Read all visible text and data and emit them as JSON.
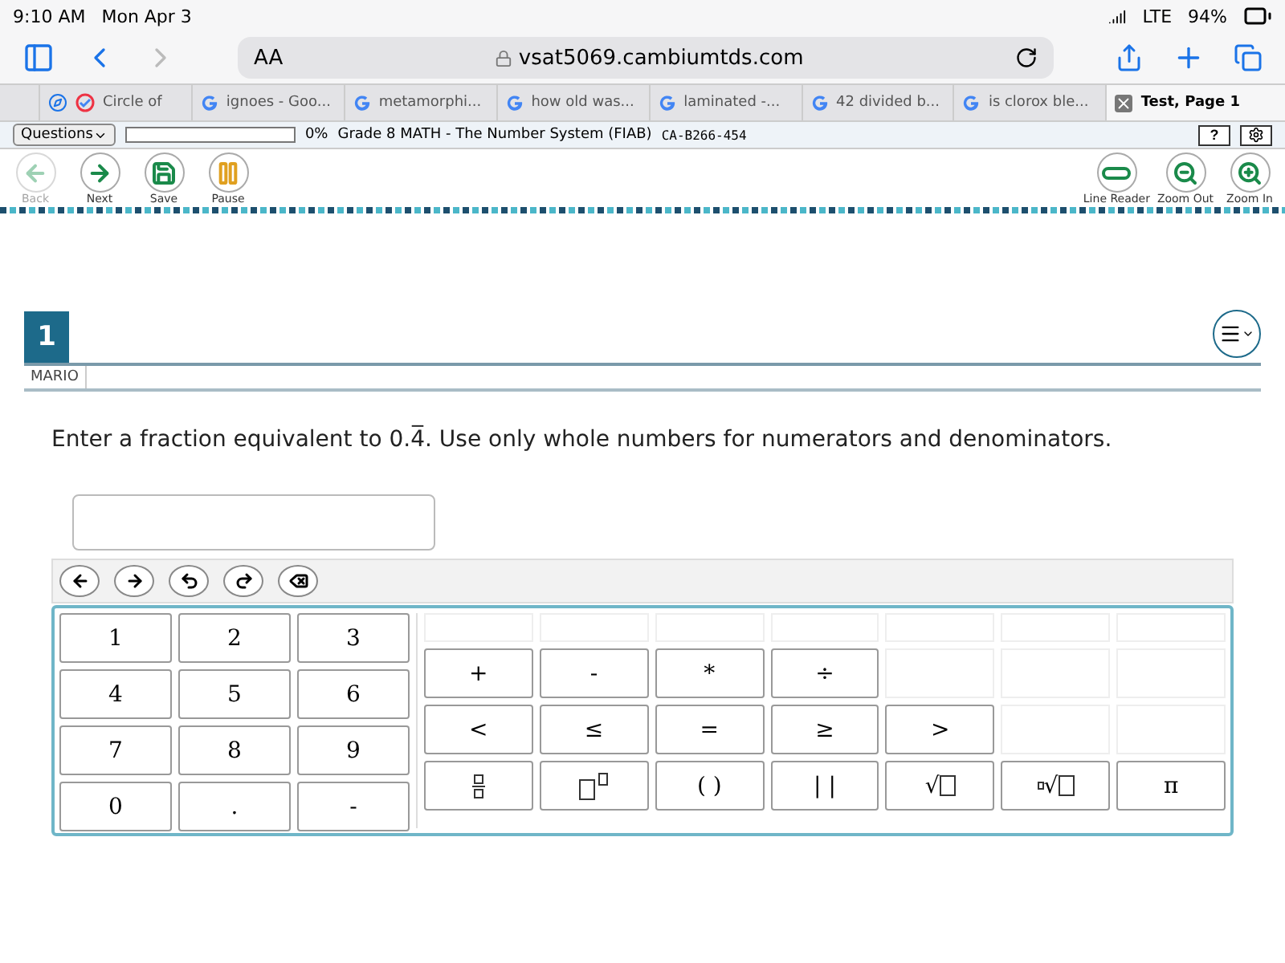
{
  "status_bar": {
    "time": "9:10 AM",
    "date": "Mon Apr 3",
    "network": "LTE",
    "battery": "94%"
  },
  "browser": {
    "text_size": "AA",
    "url": "vsat5069.cambiumtds.com",
    "tabs": [
      {
        "label": "Circle of",
        "kind": "check",
        "selected": false
      },
      {
        "label": "ignoes - Goo...",
        "kind": "google",
        "selected": false
      },
      {
        "label": "metamorphi...",
        "kind": "google",
        "selected": false
      },
      {
        "label": "how old was...",
        "kind": "google",
        "selected": false
      },
      {
        "label": "laminated -...",
        "kind": "google",
        "selected": false
      },
      {
        "label": "42 divided b...",
        "kind": "google",
        "selected": false
      },
      {
        "label": "is clorox ble...",
        "kind": "google",
        "selected": false
      },
      {
        "label": "Test, Page 1",
        "kind": "close",
        "selected": true
      }
    ]
  },
  "test_header": {
    "questions_button": "Questions",
    "progress": {
      "level": 0,
      "reading": "0%"
    },
    "title": "Grade 8 MATH - The Number System (FIAB)",
    "code": "CA-B266-454",
    "help": "?"
  },
  "tools_left": [
    {
      "label": "Back",
      "kind": "back",
      "disabled": true
    },
    {
      "label": "Next",
      "kind": "next",
      "disabled": false
    },
    {
      "label": "Save",
      "kind": "save",
      "disabled": false
    },
    {
      "label": "Pause",
      "kind": "pause",
      "disabled": false
    }
  ],
  "tools_right": [
    {
      "label": "Line Reader",
      "kind": "line",
      "disabled": false
    },
    {
      "label": "Zoom Out",
      "kind": "zoomout",
      "disabled": false
    },
    {
      "label": "Zoom In",
      "kind": "zoomin",
      "disabled": false
    }
  ],
  "question": {
    "number": "1",
    "student": "MARIO",
    "prompt": "Enter a fraction equivalent to 0.4̅. Use only whole numbers for numerators and denominators."
  },
  "editor": {
    "nav": [
      {
        "kind": "left"
      },
      {
        "kind": "right"
      },
      {
        "kind": "undo"
      },
      {
        "kind": "redo"
      },
      {
        "kind": "backspace"
      }
    ],
    "digits": [
      "1",
      "2",
      "3",
      "4",
      "5",
      "6",
      "7",
      "8",
      "9",
      "0",
      ".",
      "-"
    ],
    "symbol_rows": [
      [],
      [
        {
          "kind": "text",
          "label": "+"
        },
        {
          "kind": "text",
          "label": "-"
        },
        {
          "kind": "text",
          "label": "*"
        },
        {
          "kind": "text",
          "label": "÷"
        }
      ],
      [
        {
          "kind": "text",
          "label": "<"
        },
        {
          "kind": "text",
          "label": "≤"
        },
        {
          "kind": "text",
          "label": "="
        },
        {
          "kind": "text",
          "label": "≥"
        },
        {
          "kind": "text",
          "label": ">"
        }
      ],
      [
        {
          "kind": "fraction"
        },
        {
          "kind": "power"
        },
        {
          "kind": "text",
          "label": "( )"
        },
        {
          "kind": "text",
          "label": "| |"
        },
        {
          "kind": "sqrt",
          "label": "√"
        },
        {
          "kind": "root",
          "label": "√"
        },
        {
          "kind": "text",
          "label": "π"
        }
      ]
    ]
  }
}
